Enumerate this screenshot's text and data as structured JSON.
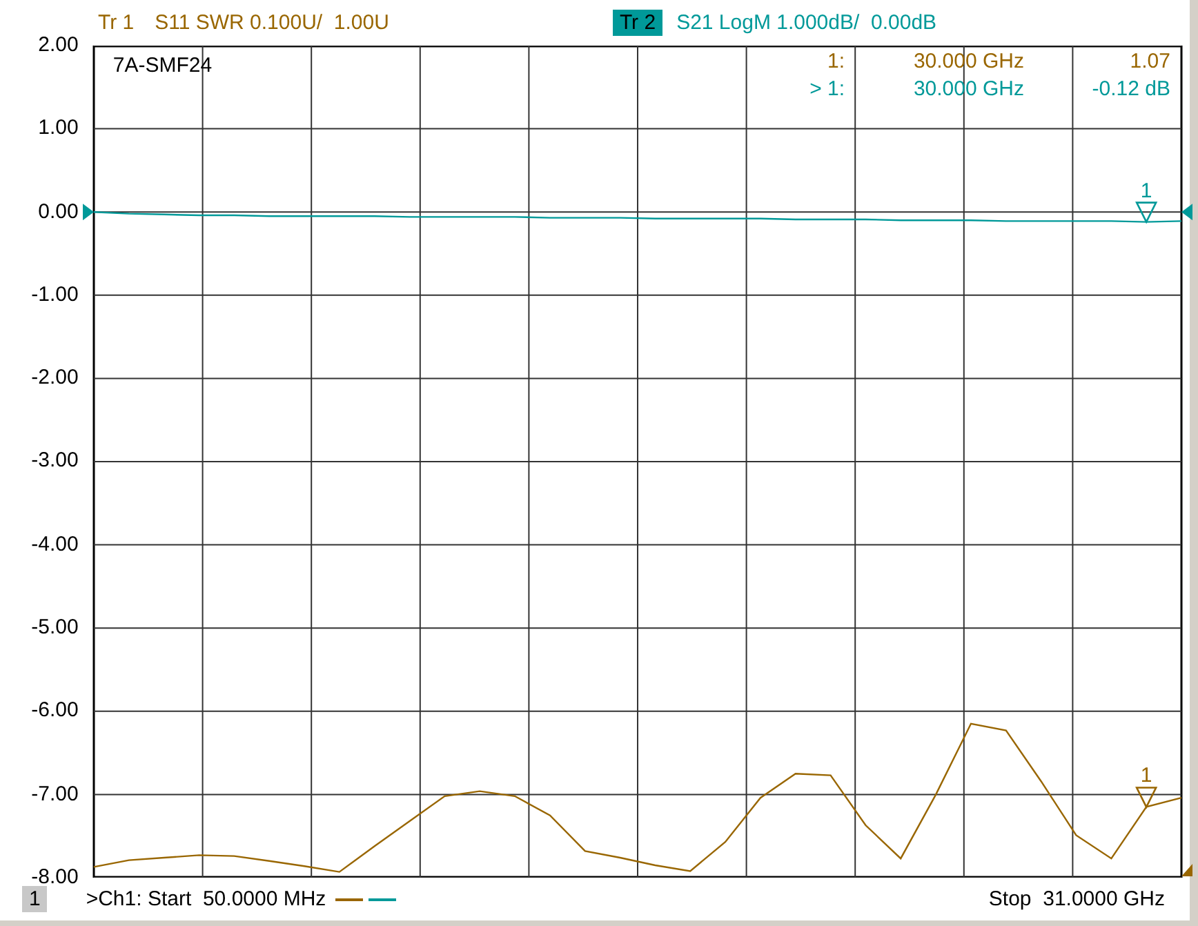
{
  "traces": [
    {
      "description": "S11 SWR 0.100U/  1.00U",
      "selected": false,
      "color": "#996600"
    },
    {
      "description": "S21 LogM 1.000dB/  0.00dB",
      "selected": true,
      "color": "#009999"
    }
  ],
  "plot_title": "7A-SMF24",
  "marker_readouts": [
    {
      "label": "1:",
      "frequency": "30.000 GHz",
      "value": "1.07",
      "color": "#996600"
    },
    {
      "label": "> 1:",
      "frequency": "30.000 GHz",
      "value": "-0.12 dB",
      "color": "#009999"
    }
  ],
  "chart_data": {
    "type": "line",
    "ylim": [
      -8,
      2
    ],
    "grid": true,
    "yticks": [
      {
        "value": 2,
        "label": "2.00"
      },
      {
        "value": 1,
        "label": "1.00"
      },
      {
        "value": 0,
        "label": "0.00"
      },
      {
        "value": -1,
        "label": "-1.00"
      },
      {
        "value": -2,
        "label": "-2.00"
      },
      {
        "value": -3,
        "label": "-3.00"
      },
      {
        "value": -4,
        "label": "-4.00"
      },
      {
        "value": -5,
        "label": "-5.00"
      },
      {
        "value": -6,
        "label": "-6.00"
      },
      {
        "value": -7,
        "label": "-7.00"
      },
      {
        "value": -8,
        "label": "-8.00"
      }
    ],
    "categories": [
      null,
      null,
      null,
      null,
      null,
      null,
      null,
      null,
      null,
      null,
      null,
      null,
      null,
      null,
      null,
      null,
      null,
      null,
      null,
      null,
      null,
      null,
      null,
      null,
      null,
      null,
      null,
      null,
      null,
      null,
      null,
      null
    ],
    "series": [
      {
        "name": "Tr 1",
        "color": "#996600",
        "values": [
          -7.87,
          -7.79,
          -7.76,
          -7.73,
          -7.74,
          -7.8,
          -7.86,
          -7.93,
          -7.62,
          -7.32,
          -7.02,
          -6.96,
          -7.02,
          -7.25,
          -7.68,
          -7.76,
          -7.85,
          -7.92,
          -7.57,
          -7.04,
          -6.75,
          -6.77,
          -7.37,
          -7.77,
          -7.0,
          -6.15,
          -6.23,
          -6.84,
          -7.49,
          -7.77,
          -7.15,
          -7.04
        ]
      },
      {
        "name": "Tr 2",
        "color": "#009999",
        "values": [
          0.0,
          -0.02,
          -0.03,
          -0.04,
          -0.04,
          -0.05,
          -0.05,
          -0.05,
          -0.05,
          -0.06,
          -0.06,
          -0.06,
          -0.06,
          -0.07,
          -0.07,
          -0.07,
          -0.08,
          -0.08,
          -0.08,
          -0.08,
          -0.09,
          -0.09,
          -0.09,
          -0.1,
          -0.1,
          -0.1,
          -0.11,
          -0.11,
          -0.11,
          -0.11,
          -0.12,
          -0.11
        ]
      }
    ]
  },
  "marker_flags": [
    {
      "label": "1",
      "color": "#009999"
    },
    {
      "label": "1",
      "color": "#996600"
    }
  ],
  "footer": {
    "channel": "1",
    "start": ">Ch1: Start  50.0000 MHz",
    "stop": "Stop  31.0000 GHz"
  }
}
